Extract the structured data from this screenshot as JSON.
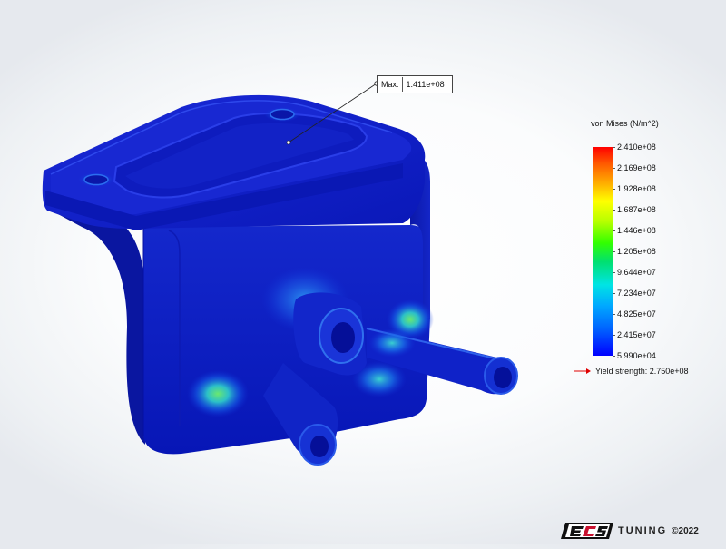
{
  "callout": {
    "label": "Max:",
    "value": "1.411e+08"
  },
  "legend": {
    "title": "von Mises (N/m^2)",
    "values": [
      "2.410e+08",
      "2.169e+08",
      "1.928e+08",
      "1.687e+08",
      "1.446e+08",
      "1.205e+08",
      "9.644e+07",
      "7.234e+07",
      "4.825e+07",
      "2.415e+07",
      "5.990e+04"
    ],
    "yield_text": "Yield strength: 2.750e+08",
    "yield_color": "#e00000"
  },
  "watermark": {
    "tuning": "TUNING",
    "copyright": "©2022"
  },
  "colors": {
    "part_blue": "#0a1ed2",
    "stress_green": "#4ad890",
    "stress_cyan": "#28b4f0"
  }
}
